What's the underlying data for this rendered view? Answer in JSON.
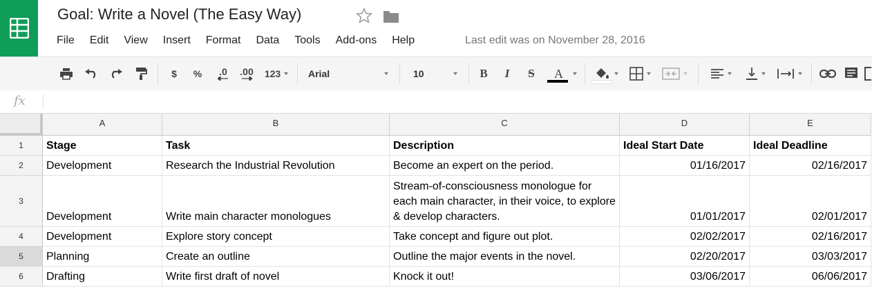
{
  "app": {
    "doc_title": "Goal: Write a Novel (The Easy Way)",
    "last_edit": "Last edit was on November 28, 2016",
    "menu": [
      "File",
      "Edit",
      "View",
      "Insert",
      "Format",
      "Data",
      "Tools",
      "Add-ons",
      "Help"
    ],
    "brand_color": "#0f9d58"
  },
  "toolbar": {
    "currency": "$",
    "percent": "%",
    "decrease_decimal": ".0",
    "increase_decimal": ".00",
    "more_formats": "123",
    "font": "Arial",
    "font_size": "10",
    "bold": "B",
    "italic": "I",
    "strike": "S",
    "text_color": "A"
  },
  "formula_bar": {
    "label": "fx",
    "value": ""
  },
  "sheet": {
    "columns": [
      "A",
      "B",
      "C",
      "D",
      "E"
    ],
    "rows": [
      {
        "num": "1",
        "cells": [
          "Stage",
          "Task",
          "Description",
          "Ideal Start Date",
          "Ideal Deadline"
        ]
      },
      {
        "num": "2",
        "cells": [
          "Development",
          "Research the Industrial Revolution",
          "Become an expert on the period.",
          "01/16/2017",
          "02/16/2017"
        ]
      },
      {
        "num": "3",
        "cells": [
          "Development",
          "Write main character monologues",
          "Stream-of-consciousness monologue for each main character, in their voice, to explore & develop characters.",
          "01/01/2017",
          "02/01/2017"
        ]
      },
      {
        "num": "4",
        "cells": [
          "Development",
          "Explore story concept",
          "Take concept and figure out plot.",
          "02/02/2017",
          "02/16/2017"
        ]
      },
      {
        "num": "5",
        "cells": [
          "Planning",
          "Create an outline",
          "Outline the major events in the novel.",
          "02/20/2017",
          "03/03/2017"
        ]
      },
      {
        "num": "6",
        "cells": [
          "Drafting",
          "Write first draft of novel",
          "Knock it out!",
          "03/06/2017",
          "06/06/2017"
        ]
      }
    ],
    "selected_row": "5"
  }
}
